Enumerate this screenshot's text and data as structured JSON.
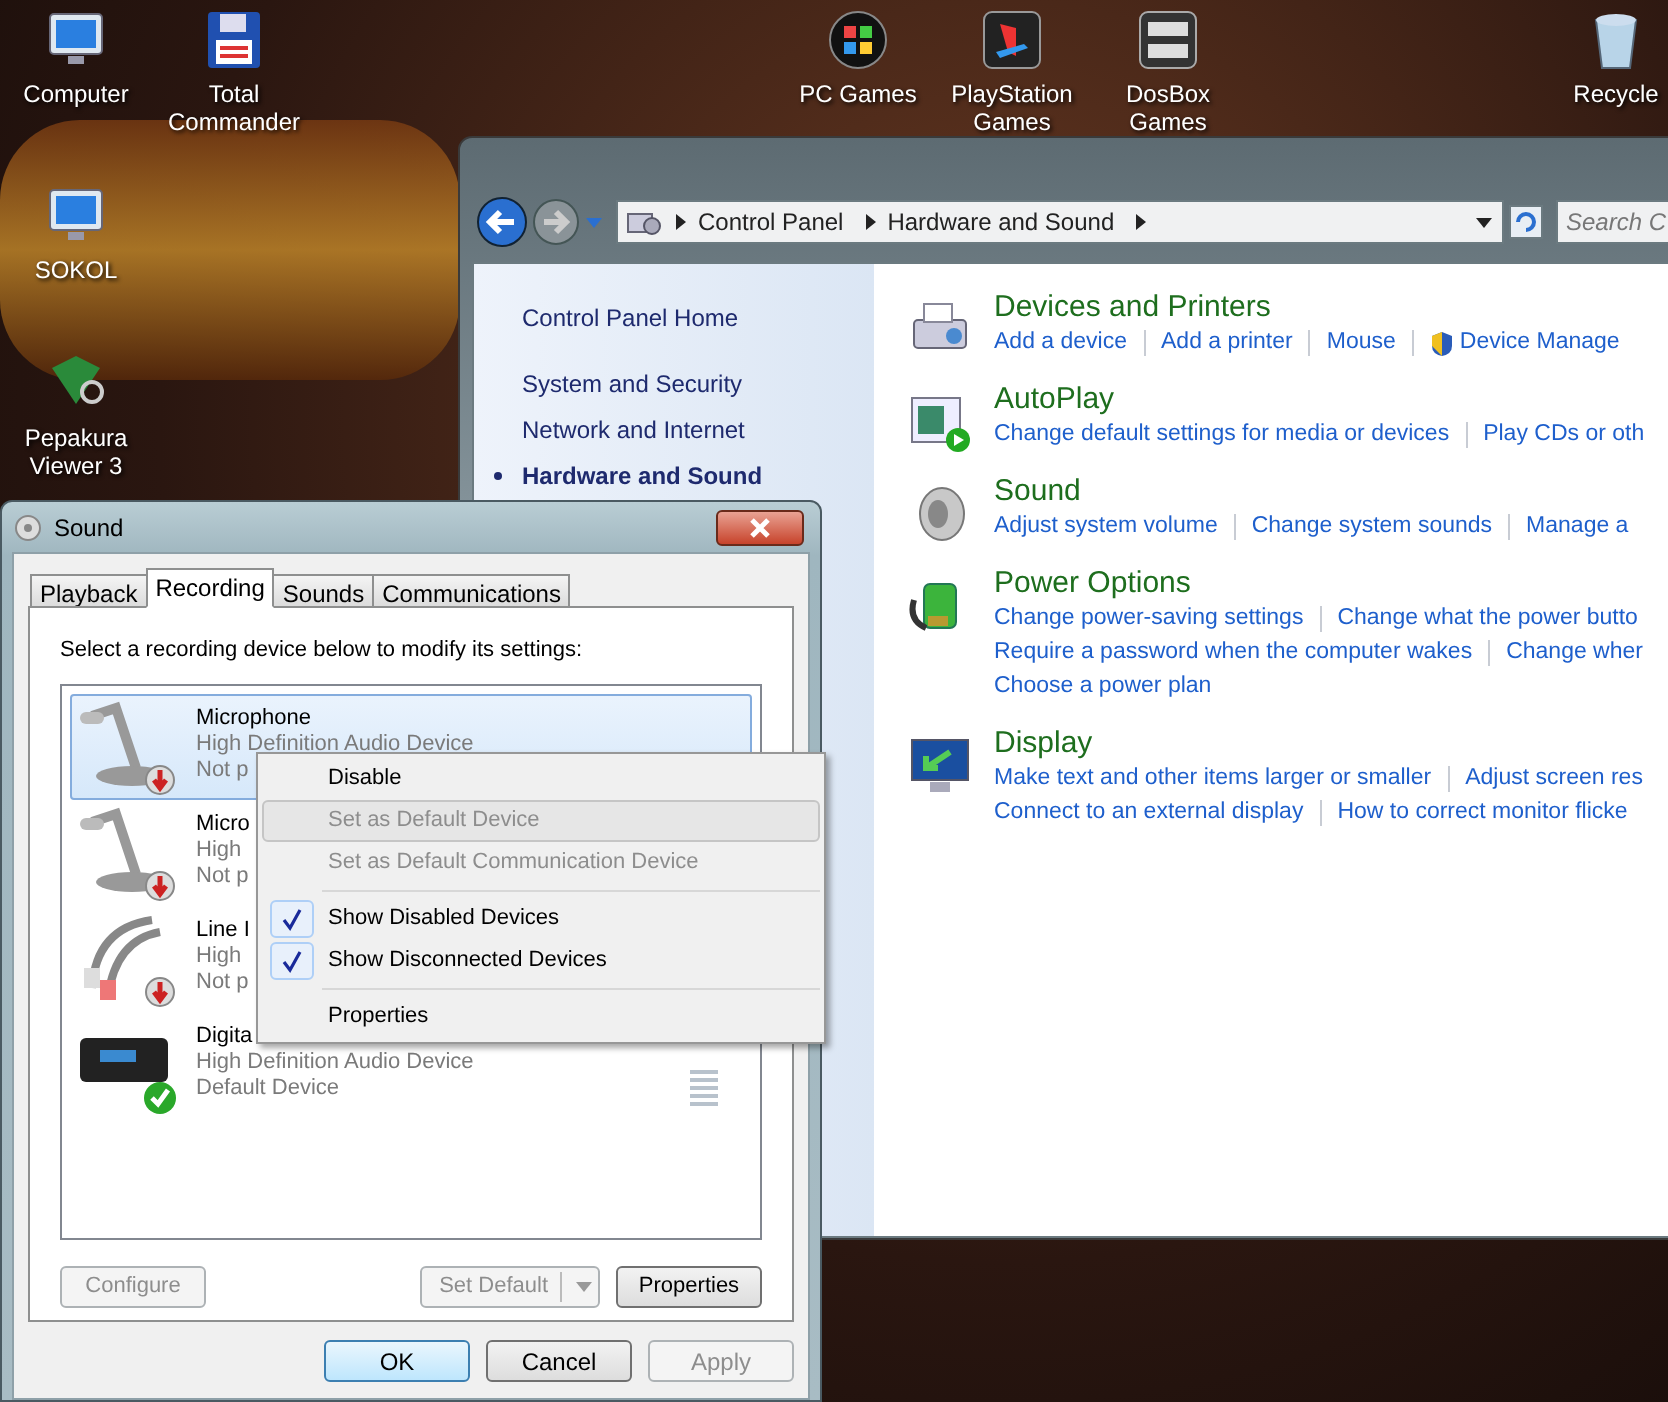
{
  "desktop_icons": [
    {
      "label": "Computer",
      "kind": "computer"
    },
    {
      "label": "Total Commander",
      "kind": "floppy"
    },
    {
      "label": "PC Games",
      "kind": "orb"
    },
    {
      "label": "PlayStation Games",
      "kind": "playstation"
    },
    {
      "label": "DosBox Games",
      "kind": "dosbox"
    },
    {
      "label": "Recycle",
      "kind": "bin"
    },
    {
      "label": "SOKOL",
      "kind": "computer"
    },
    {
      "label": "Pepakura Viewer 3",
      "kind": "pepakura"
    }
  ],
  "control_panel": {
    "breadcrumb": [
      "Control Panel",
      "Hardware and Sound"
    ],
    "search": {
      "placeholder": "Search C"
    },
    "nav": [
      {
        "label": "Control Panel Home",
        "selected": false
      },
      {
        "label": "System and Security",
        "selected": false
      },
      {
        "label": "Network and Internet",
        "selected": false
      },
      {
        "label": "Hardware and Sound",
        "selected": true
      }
    ],
    "categories": [
      {
        "title": "Devices and Printers",
        "kind": "printer",
        "link_lines": [
          [
            "Add a device",
            "Add a printer",
            "Mouse",
            "Device Manage"
          ]
        ]
      },
      {
        "title": "AutoPlay",
        "kind": "autoplay",
        "link_lines": [
          [
            "Change default settings for media or devices",
            "Play CDs or oth"
          ]
        ]
      },
      {
        "title": "Sound",
        "kind": "speaker",
        "link_lines": [
          [
            "Adjust system volume",
            "Change system sounds",
            "Manage a"
          ]
        ]
      },
      {
        "title": "Power Options",
        "kind": "battery",
        "link_lines": [
          [
            "Change power-saving settings",
            "Change what the power butto"
          ],
          [
            "Require a password when the computer wakes",
            "Change wher"
          ],
          [
            "Choose a power plan"
          ]
        ]
      },
      {
        "title": "Display",
        "kind": "monitor",
        "link_lines": [
          [
            "Make text and other items larger or smaller",
            "Adjust screen res"
          ],
          [
            "Connect to an external display",
            "How to correct monitor flicke"
          ]
        ]
      }
    ]
  },
  "sound_dialog": {
    "title": "Sound",
    "tabs": [
      {
        "label": "Playback",
        "selected": false
      },
      {
        "label": "Recording",
        "selected": true
      },
      {
        "label": "Sounds",
        "selected": false
      },
      {
        "label": "Communications",
        "selected": false
      }
    ],
    "instruction": "Select a recording device below to modify its settings:",
    "devices": [
      {
        "kind": "microphone",
        "unplugged": true,
        "default": false,
        "lines": [
          "Microphone",
          "High Definition Audio Device",
          "Not p"
        ],
        "selected": true
      },
      {
        "kind": "microphone",
        "unplugged": true,
        "default": false,
        "lines": [
          "Micro",
          "High",
          "Not p"
        ],
        "selected": false
      },
      {
        "kind": "cable",
        "unplugged": true,
        "default": false,
        "lines": [
          "Line I",
          "High",
          "Not p"
        ],
        "selected": false
      },
      {
        "kind": "receiver",
        "unplugged": false,
        "default": true,
        "lines": [
          "Digita",
          "High Definition Audio Device",
          "Default Device"
        ],
        "selected": false
      }
    ],
    "buttons": [
      {
        "label": "Configure",
        "disabled": true,
        "kind": "plain"
      },
      {
        "label": "Set Default",
        "disabled": true,
        "kind": "split"
      },
      {
        "label": "Properties",
        "disabled": false,
        "kind": "plain"
      }
    ],
    "footer_buttons": [
      {
        "label": "OK",
        "disabled": false,
        "default": true
      },
      {
        "label": "Cancel",
        "disabled": false,
        "default": false
      },
      {
        "label": "Apply",
        "disabled": true,
        "default": false
      }
    ]
  },
  "context_menu": [
    {
      "kind": "item",
      "label": "Disable",
      "disabled": false,
      "checked": false,
      "selected": false
    },
    {
      "kind": "item",
      "label": "Set as Default Device",
      "disabled": true,
      "checked": false,
      "selected": true
    },
    {
      "kind": "item",
      "label": "Set as Default Communication Device",
      "disabled": true,
      "checked": false,
      "selected": false
    },
    {
      "kind": "separator"
    },
    {
      "kind": "item",
      "label": "Show Disabled Devices",
      "disabled": false,
      "checked": true,
      "selected": false
    },
    {
      "kind": "item",
      "label": "Show Disconnected Devices",
      "disabled": false,
      "checked": true,
      "selected": false
    },
    {
      "kind": "separator"
    },
    {
      "kind": "item",
      "label": "Properties",
      "disabled": false,
      "checked": false,
      "selected": false
    }
  ]
}
